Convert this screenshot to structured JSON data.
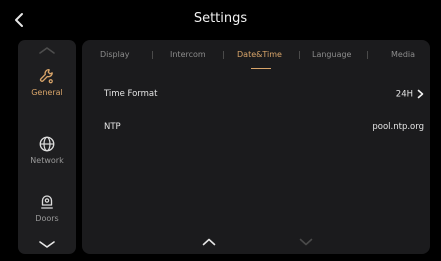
{
  "header": {
    "title": "Settings"
  },
  "sidebar": {
    "items": [
      {
        "label": "General",
        "icon": "wrench-icon",
        "active": true
      },
      {
        "label": "Network",
        "icon": "globe-icon",
        "active": false
      },
      {
        "label": "Doors",
        "icon": "doorbell-icon",
        "active": false
      }
    ]
  },
  "tabs": [
    {
      "label": "Display"
    },
    {
      "label": "Intercom"
    },
    {
      "label": "Date&Time"
    },
    {
      "label": "Language"
    },
    {
      "label": "Media"
    }
  ],
  "settings": {
    "time_format": {
      "label": "Time Format",
      "value": "24H"
    },
    "ntp": {
      "label": "NTP",
      "value": "pool.ntp.org"
    }
  },
  "colors": {
    "accent": "#d9a56a",
    "background": "#000000",
    "panel": "#1b1b1d",
    "sidebar": "#1e1e20"
  }
}
